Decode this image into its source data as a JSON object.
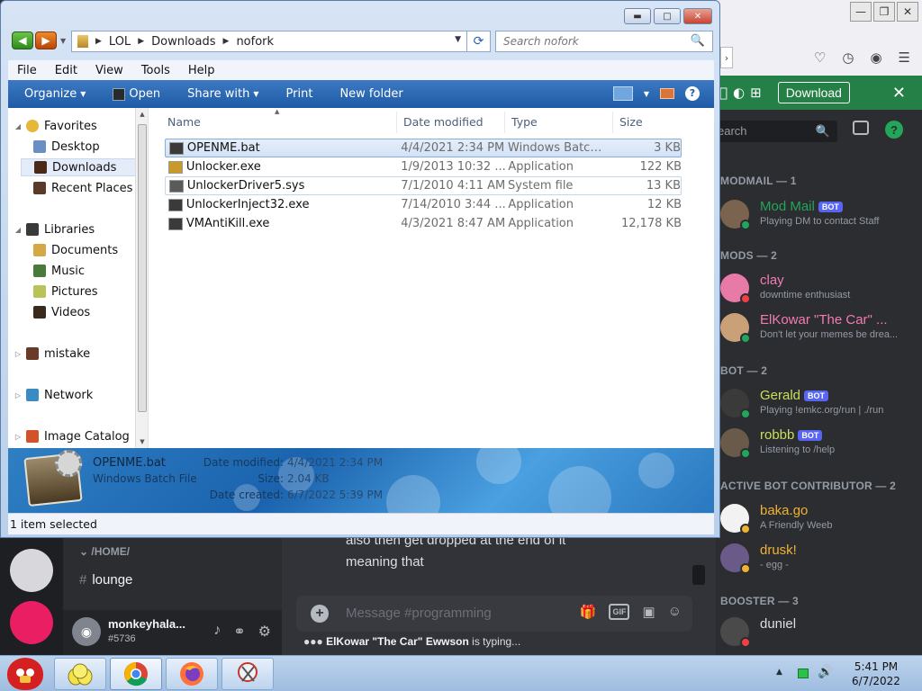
{
  "explorer": {
    "address": [
      "LOL",
      "Downloads",
      "nofork"
    ],
    "search_placeholder": "Search nofork",
    "menu": [
      "File",
      "Edit",
      "View",
      "Tools",
      "Help"
    ],
    "commands": [
      "Organize",
      "Open",
      "Share with",
      "Print",
      "New folder"
    ],
    "nav": [
      {
        "label": "Favorites",
        "icon": "star-icon",
        "color": "#e7b73a"
      },
      {
        "label": "Desktop",
        "icon": "desktop-icon",
        "color": "#6b8fc4"
      },
      {
        "label": "Downloads",
        "icon": "downloads-icon",
        "color": "#4a2a16",
        "selected": true
      },
      {
        "label": "Recent Places",
        "icon": "recent-places-icon",
        "color": "#5a3a28"
      },
      {
        "label": "Libraries",
        "icon": "libraries-icon",
        "color": "#3a3a3a"
      },
      {
        "label": "Documents",
        "icon": "documents-icon",
        "color": "#d6a845"
      },
      {
        "label": "Music",
        "icon": "music-icon",
        "color": "#4a7a3a"
      },
      {
        "label": "Pictures",
        "icon": "pictures-icon",
        "color": "#b9c35a"
      },
      {
        "label": "Videos",
        "icon": "videos-icon",
        "color": "#3a2a1e"
      },
      {
        "label": "mistake",
        "icon": "mistake-icon",
        "color": "#6a3a28"
      },
      {
        "label": "Network",
        "icon": "network-icon",
        "color": "#3a8ac4"
      },
      {
        "label": "Image Catalog",
        "icon": "image-catalog-icon",
        "color": "#d2532a"
      }
    ],
    "columns": {
      "name": "Name",
      "date": "Date modified",
      "type": "Type",
      "size": "Size"
    },
    "files": [
      {
        "name": "OPENME.bat",
        "date": "4/4/2021 2:34 PM",
        "type": "Windows Batch ...",
        "size": "3 KB"
      },
      {
        "name": "Unlocker.exe",
        "date": "1/9/2013 10:32 ...",
        "type": "Application",
        "size": "122 KB"
      },
      {
        "name": "UnlockerDriver5.sys",
        "date": "7/1/2010 4:11 AM",
        "type": "System file",
        "size": "13 KB"
      },
      {
        "name": "UnlockerInject32.exe",
        "date": "7/14/2010 3:44 ...",
        "type": "Application",
        "size": "12 KB"
      },
      {
        "name": "VMAntiKill.exe",
        "date": "4/3/2021 8:47 AM",
        "type": "Application",
        "size": "12,178 KB"
      }
    ],
    "details": {
      "name": "OPENME.bat",
      "type": "Windows Batch File",
      "date_modified_label": "Date modified:",
      "date_modified": "4/4/2021 2:34 PM",
      "size_label": "Size:",
      "size": "2.04 KB",
      "date_created_label": "Date created:",
      "date_created": "6/7/2022 5:39 PM"
    },
    "status": "1 item selected"
  },
  "discord": {
    "download_label": "Download",
    "search_placeholder": "earch",
    "groups": [
      {
        "label": "MODMAIL — 1",
        "members": [
          {
            "name": "Mod Mail",
            "bot": true,
            "sub": "Playing DM to contact Staff",
            "color": "#23a55a",
            "status": "#23a55a",
            "avatar": "#7a6450"
          }
        ]
      },
      {
        "label": "MODS — 2",
        "members": [
          {
            "name": "clay",
            "bot": false,
            "sub": "downtime enthusiast",
            "color": "#f37bb5",
            "status": "#f23f43",
            "avatar": "#e87aa8"
          },
          {
            "name": "ElKowar \"The Car\" ...",
            "bot": false,
            "sub": "Don't let your memes be drea...",
            "color": "#f37bb5",
            "status": "#23a55a",
            "avatar": "#c9a077"
          }
        ]
      },
      {
        "label": "BOT — 2",
        "members": [
          {
            "name": "Gerald",
            "bot": true,
            "sub": "Playing !emkc.org/run | ./run",
            "color": "#c7e05a",
            "status": "#23a55a",
            "avatar": "#3a3a3a"
          },
          {
            "name": "robbb",
            "bot": true,
            "sub": "Listening to /help",
            "color": "#c7e05a",
            "status": "#23a55a",
            "avatar": "#6a5a4a"
          }
        ]
      },
      {
        "label": "ACTIVE BOT CONTRIBUTOR — 2",
        "members": [
          {
            "name": "baka.go",
            "bot": false,
            "sub": "A Friendly Weeb",
            "color": "#f0b232",
            "status": "#f0b232",
            "avatar": "#f2f2f2"
          },
          {
            "name": "drusk!",
            "bot": false,
            "sub": "- egg -",
            "color": "#f0b232",
            "status": "#f0b232",
            "avatar": "#6a5a8a"
          }
        ]
      },
      {
        "label": "BOOSTER — 3",
        "members": [
          {
            "name": "duniel",
            "bot": false,
            "sub": "",
            "color": "#dbdee1",
            "status": "#f23f43",
            "avatar": "#4a4a4a"
          }
        ]
      }
    ],
    "bot_badge": "BOT",
    "category": "/HOME/",
    "channel": "lounge",
    "message_lines": [
      "also then get dropped at the end of it",
      "meaning that"
    ],
    "message_placeholder": "Message #programming",
    "gif_label": "GIF",
    "typing_user": "ElKowar \"The Car\" Ewwson",
    "typing_suffix": " is typing...",
    "user": {
      "name": "monkeyhala...",
      "tag": "#5736"
    }
  },
  "taskbar": {
    "time": "5:41 PM",
    "date": "6/7/2022"
  }
}
